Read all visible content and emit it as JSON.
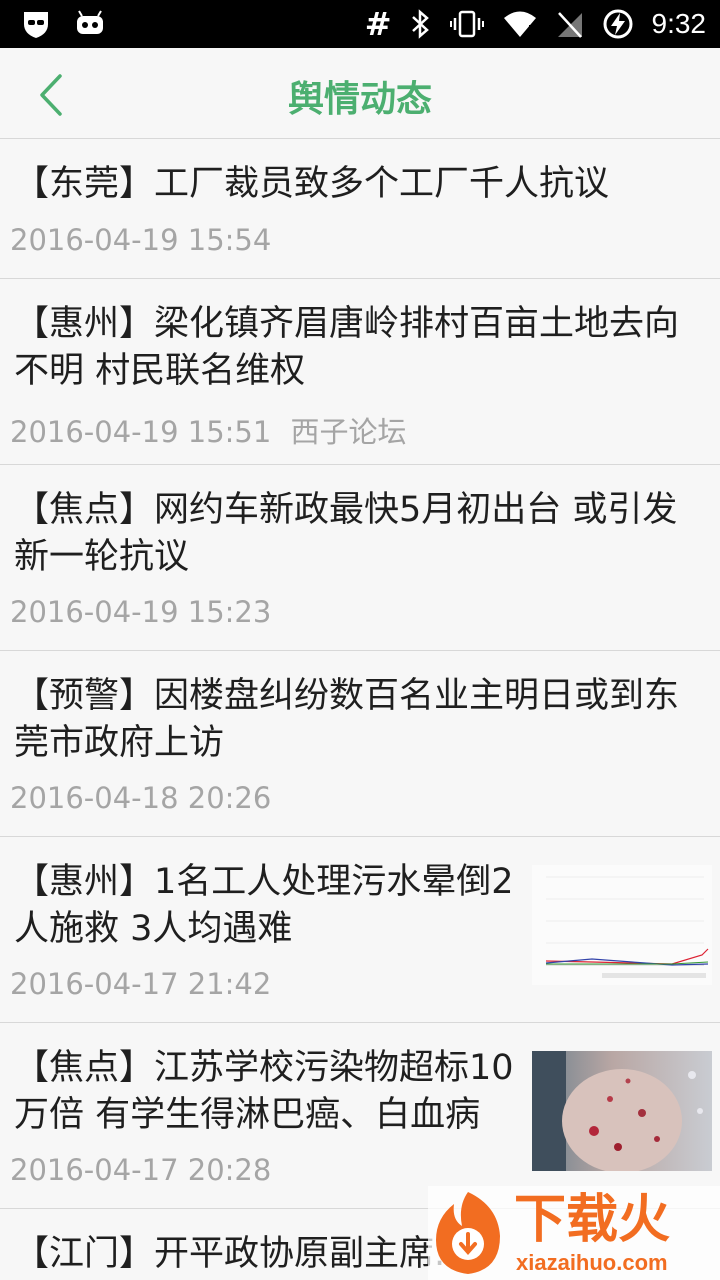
{
  "status_bar": {
    "time": "9:32",
    "icons": [
      "privacy-mask-icon",
      "android-debug-icon",
      "hash-icon",
      "bluetooth-icon",
      "vibrate-icon",
      "wifi-icon",
      "no-signal-icon",
      "battery-charging-icon"
    ]
  },
  "header": {
    "title": "舆情动态",
    "back_icon": "chevron-left-icon"
  },
  "colors": {
    "accent": "#4caf70",
    "headline": "#1f1f1f",
    "meta": "#a5a5a5",
    "divider": "#d8d8d8"
  },
  "news": [
    {
      "headline": "【东莞】工厂裁员致多个工厂千人抗议",
      "date": "2016-04-19 15:54",
      "source": ""
    },
    {
      "headline": "【惠州】梁化镇齐眉唐岭排村百亩土地去向不明 村民联名维权",
      "date": "2016-04-19 15:51",
      "source": "西子论坛"
    },
    {
      "headline": "【焦点】网约车新政最快5月初出台 或引发新一轮抗议",
      "date": "2016-04-19 15:23",
      "source": ""
    },
    {
      "headline": "【预警】因楼盘纠纷数百名业主明日或到东莞市政府上访",
      "date": "2016-04-18 20:26",
      "source": ""
    },
    {
      "headline": "【惠州】1名工人处理污水晕倒2人施救 3人均遇难",
      "date": "2016-04-17 21:42",
      "source": "",
      "thumbnail": "line-chart-thumbnail"
    },
    {
      "headline": "【焦点】江苏学校污染物超标10万倍 有学生得淋巴癌、白血病",
      "date": "2016-04-17 20:28",
      "source": "",
      "thumbnail": "skin-rash-photo-thumbnail"
    },
    {
      "headline": "【江门】开平政协原副主席...",
      "date": "",
      "source": ""
    }
  ],
  "watermark": {
    "text": "下载火",
    "sub": "xiazaihuo.com"
  }
}
